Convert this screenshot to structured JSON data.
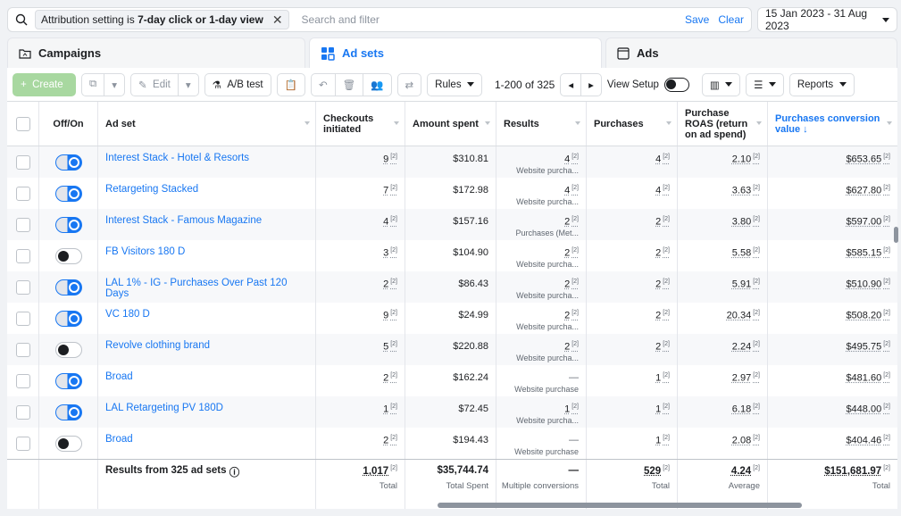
{
  "filter": {
    "attribution_prefix": "Attribution setting is ",
    "attribution_value": "7-day click or 1-day view",
    "placeholder": "Search and filter",
    "save": "Save",
    "clear": "Clear"
  },
  "date_range": "15 Jan 2023 - 31 Aug 2023",
  "tabs": [
    {
      "label": "Campaigns"
    },
    {
      "label": "Ad sets"
    },
    {
      "label": "Ads"
    }
  ],
  "toolbar": {
    "create": "Create",
    "edit": "Edit",
    "ab_test": "A/B test",
    "rules": "Rules",
    "pager": "1-200 of 325",
    "view_setup": "View Setup",
    "reports": "Reports"
  },
  "columns": [
    "Off/On",
    "Ad set",
    "Checkouts initiated",
    "Amount spent",
    "Results",
    "Purchases",
    "Purchase ROAS (return on ad spend)",
    "Purchases conversion value ↓"
  ],
  "rows": [
    {
      "on": true,
      "name": "Interest Stack - Hotel & Resorts",
      "checkouts": "9",
      "spent": "$310.81",
      "results": "4",
      "results_sub": "Website purcha...",
      "purchases": "4",
      "roas": "2.10",
      "value": "$653.65"
    },
    {
      "on": true,
      "name": "Retargeting Stacked",
      "checkouts": "7",
      "spent": "$172.98",
      "results": "4",
      "results_sub": "Website purcha...",
      "purchases": "4",
      "roas": "3.63",
      "value": "$627.80"
    },
    {
      "on": true,
      "name": "Interest Stack - Famous Magazine",
      "checkouts": "4",
      "spent": "$157.16",
      "results": "2",
      "results_sub": "Purchases (Met...",
      "purchases": "2",
      "roas": "3.80",
      "value": "$597.00"
    },
    {
      "on": false,
      "name": "FB Visitors 180 D",
      "checkouts": "3",
      "spent": "$104.90",
      "results": "2",
      "results_sub": "Website purcha...",
      "purchases": "2",
      "roas": "5.58",
      "value": "$585.15"
    },
    {
      "on": true,
      "name": "LAL 1% - IG - Purchases Over Past 120 Days",
      "checkouts": "2",
      "spent": "$86.43",
      "results": "2",
      "results_sub": "Website purcha...",
      "purchases": "2",
      "roas": "5.91",
      "value": "$510.90"
    },
    {
      "on": true,
      "name": "VC 180 D",
      "checkouts": "9",
      "spent": "$24.99",
      "results": "2",
      "results_sub": "Website purcha...",
      "purchases": "2",
      "roas": "20.34",
      "value": "$508.20"
    },
    {
      "on": false,
      "name": "Revolve clothing brand",
      "checkouts": "5",
      "spent": "$220.88",
      "results": "2",
      "results_sub": "Website purcha...",
      "purchases": "2",
      "roas": "2.24",
      "value": "$495.75"
    },
    {
      "on": true,
      "name": "Broad",
      "checkouts": "2",
      "spent": "$162.24",
      "results": "—",
      "results_sub": "Website purchase",
      "purchases": "1",
      "roas": "2.97",
      "value": "$481.60"
    },
    {
      "on": true,
      "name": "LAL Retargeting PV 180D",
      "checkouts": "1",
      "spent": "$72.45",
      "results": "1",
      "results_sub": "Website purcha...",
      "purchases": "1",
      "roas": "6.18",
      "value": "$448.00"
    },
    {
      "on": false,
      "name": "Broad",
      "checkouts": "2",
      "spent": "$194.43",
      "results": "—",
      "results_sub": "Website purchase",
      "purchases": "1",
      "roas": "2.08",
      "value": "$404.46"
    }
  ],
  "footnote_marker": "[2]",
  "totals": {
    "label": "Results from 325 ad sets",
    "checkouts": "1,017",
    "checkouts_sub": "Total",
    "spent": "$35,744.74",
    "spent_sub": "Total Spent",
    "results": "—",
    "results_sub": "Multiple conversions",
    "purchases": "529",
    "purchases_sub": "Total",
    "roas": "4.24",
    "roas_sub": "Average",
    "value": "$151,681.97",
    "value_sub": "Total"
  }
}
